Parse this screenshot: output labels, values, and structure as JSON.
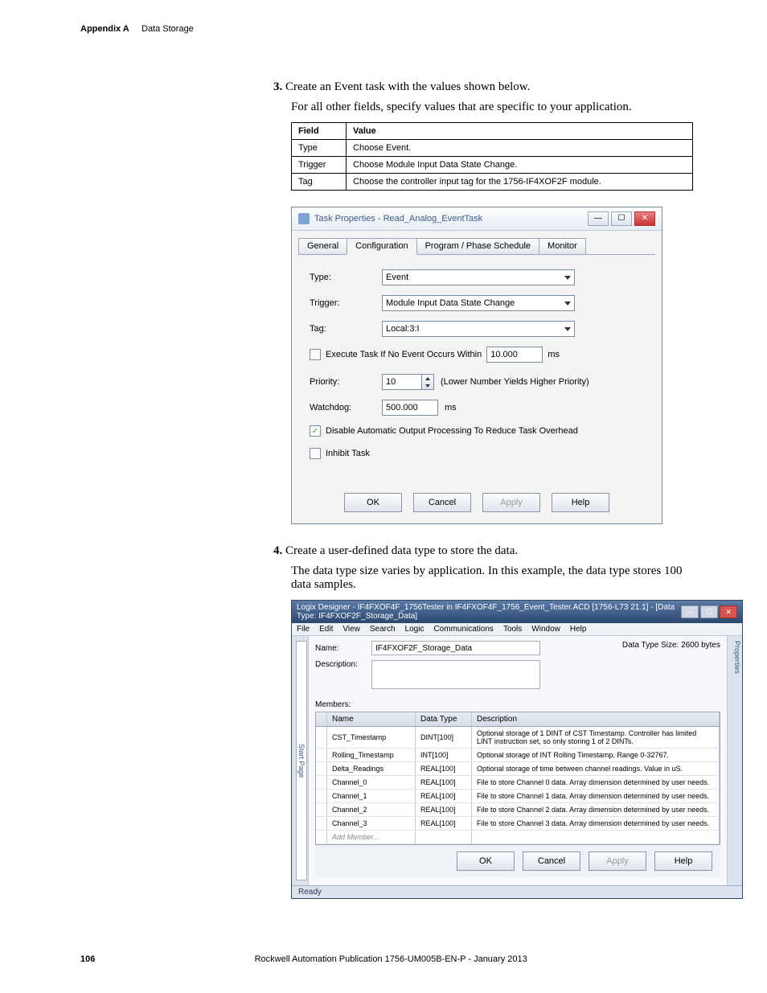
{
  "header": {
    "appendix": "Appendix A",
    "section": "Data Storage"
  },
  "steps": {
    "s3": {
      "num": "3.",
      "text": "Create an Event task with the values shown below.",
      "sub": "For all other fields, specify values that are specific to your application.",
      "table": {
        "h1": "Field",
        "h2": "Value",
        "rows": [
          {
            "f": "Type",
            "v": "Choose Event."
          },
          {
            "f": "Trigger",
            "v": "Choose Module Input Data State Change."
          },
          {
            "f": "Tag",
            "v": "Choose the controller input tag for the 1756-IF4XOF2F module."
          }
        ]
      }
    },
    "s4": {
      "num": "4.",
      "text": "Create a user-defined data type to store the data.",
      "sub": "The data type size varies by application. In this example, the data type stores 100 data samples."
    }
  },
  "task_dialog": {
    "title": "Task Properties - Read_Analog_EventTask",
    "tabs": {
      "general": "General",
      "configuration": "Configuration",
      "schedule": "Program / Phase Schedule",
      "monitor": "Monitor"
    },
    "fields": {
      "type_label": "Type:",
      "type_value": "Event",
      "trigger_label": "Trigger:",
      "trigger_value": "Module Input Data State Change",
      "tag_label": "Tag:",
      "tag_value": "Local:3:I",
      "execute_label": "Execute Task If No Event Occurs Within",
      "execute_value": "10.000",
      "execute_unit": "ms",
      "priority_label": "Priority:",
      "priority_value": "10",
      "priority_hint": "(Lower Number Yields Higher Priority)",
      "watchdog_label": "Watchdog:",
      "watchdog_value": "500.000",
      "watchdog_unit": "ms",
      "disable_auto": "Disable Automatic Output Processing To Reduce Task Overhead",
      "inhibit": "Inhibit Task"
    },
    "buttons": {
      "ok": "OK",
      "cancel": "Cancel",
      "apply": "Apply",
      "help": "Help"
    }
  },
  "logix": {
    "title": "Logix Designer - IF4FXOF4F_1756Tester in IF4FXOF4F_1756_Event_Tester.ACD [1756-L73 21.1] - [Data Type: IF4FXOF2F_Storage_Data]",
    "menu": [
      "File",
      "Edit",
      "View",
      "Search",
      "Logic",
      "Communications",
      "Tools",
      "Window",
      "Help"
    ],
    "side": {
      "start": "Start Page"
    },
    "rightab": "Properties",
    "name_label": "Name:",
    "name_value": "IF4FXOF2F_Storage_Data",
    "desc_label": "Description:",
    "desc_value": "",
    "size_label": "Data Type Size: 2600 bytes",
    "members_label": "Members:",
    "cols": {
      "name": "Name",
      "type": "Data Type",
      "desc": "Description"
    },
    "rows": [
      {
        "name": "CST_Timestamp",
        "type": "DINT[100]",
        "desc": "Optional storage of 1 DINT of CST Timestamp. Controller has limited LINT instruction set, so only storing 1 of 2 DINTs."
      },
      {
        "name": "Rolling_Timestamp",
        "type": "INT[100]",
        "desc": "Optional storage of INT Rolling Timestamp. Range 0-32767."
      },
      {
        "name": "Delta_Readings",
        "type": "REAL[100]",
        "desc": "Optional storage of time between channel readings. Value in uS."
      },
      {
        "name": "Channel_0",
        "type": "REAL[100]",
        "desc": "File to store Channel 0 data. Array dimension determined by user needs."
      },
      {
        "name": "Channel_1",
        "type": "REAL[100]",
        "desc": "File to store Channel 1 data. Array dimension determined by user needs."
      },
      {
        "name": "Channel_2",
        "type": "REAL[100]",
        "desc": "File to store Channel 2 data. Array dimension determined by user needs."
      },
      {
        "name": "Channel_3",
        "type": "REAL[100]",
        "desc": "File to store Channel 3 data. Array dimension determined by user needs."
      }
    ],
    "add_member": "Add Member...",
    "buttons": {
      "ok": "OK",
      "cancel": "Cancel",
      "apply": "Apply",
      "help": "Help"
    },
    "status": "Ready"
  },
  "footer": {
    "page": "106",
    "pub": "Rockwell Automation Publication 1756-UM005B-EN-P - January 2013"
  }
}
